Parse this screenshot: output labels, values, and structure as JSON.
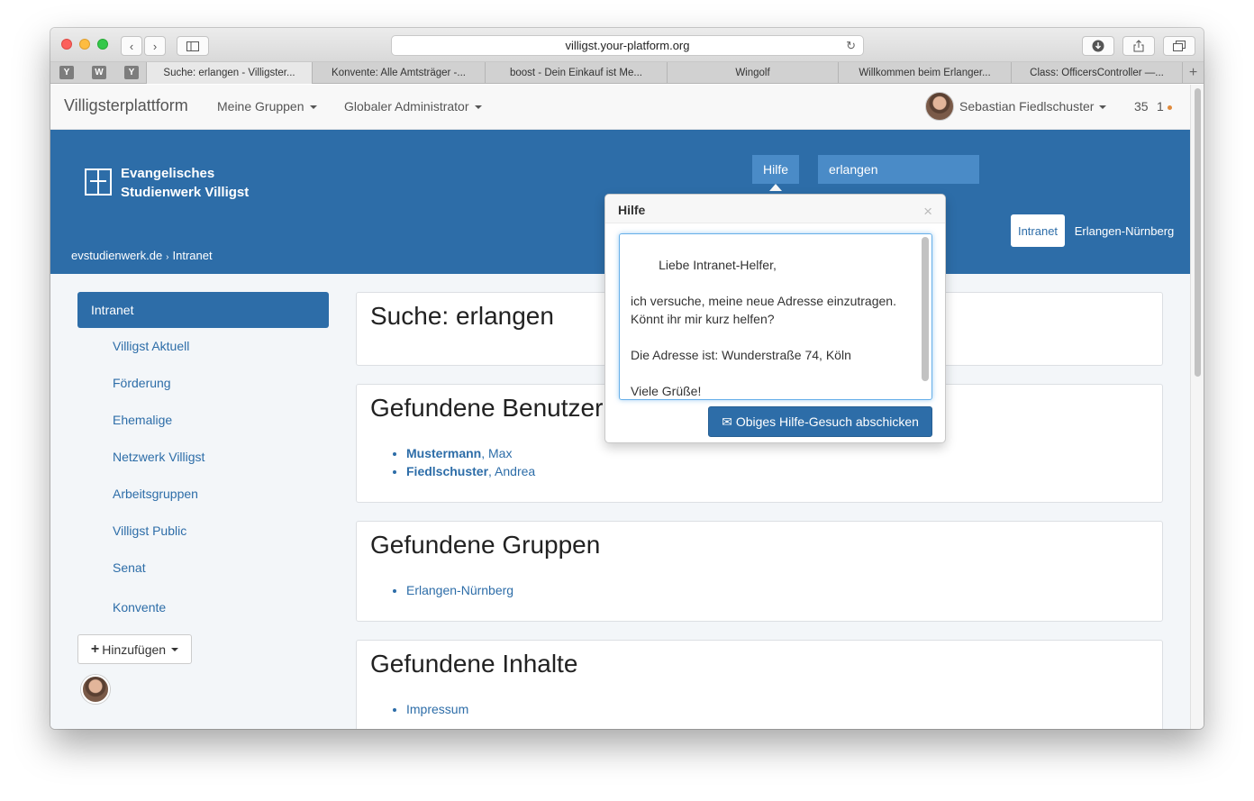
{
  "browser": {
    "url": "villigst.your-platform.org",
    "pinned": [
      "Y",
      "W",
      "Y"
    ],
    "tabs": [
      "Suche: erlangen - Villigster...",
      "Konvente: Alle Amtsträger -...",
      "boost - Dein Einkauf ist Me...",
      "Wingolf",
      "Willkommen beim Erlanger...",
      "Class: OfficersController —..."
    ],
    "new_tab": "+"
  },
  "navbar": {
    "brand": "Villigsterplattform",
    "menu": [
      "Meine Gruppen",
      "Globaler Administrator"
    ],
    "user": "Sebastian Fiedlschuster",
    "count": "35",
    "notifications": "1"
  },
  "header": {
    "logo_line1": "Evangelisches",
    "logo_line2": "Studienwerk Villigst",
    "help": "Hilfe",
    "search_value": "erlangen",
    "breadcrumb": [
      "evstudienwerk.de",
      "Intranet"
    ],
    "pills": [
      "Intranet",
      "Erlangen-Nürnberg"
    ]
  },
  "sidebar": {
    "active": "Intranet",
    "items": [
      "Villigst Aktuell",
      "Förderung",
      "Ehemalige",
      "Netzwerk Villigst",
      "Arbeitsgruppen",
      "Villigst Public",
      "Senat",
      "Konvente"
    ],
    "add_button": "Hinzufügen"
  },
  "main": {
    "search_title": "Suche: erlangen",
    "users_title": "Gefundene Benutzer",
    "users": [
      {
        "last": "Mustermann",
        "first": ", Max"
      },
      {
        "last": "Fiedlschuster",
        "first": ", Andrea"
      }
    ],
    "groups_title": "Gefundene Gruppen",
    "groups": [
      "Erlangen-Nürnberg"
    ],
    "contents_title": "Gefundene Inhalte",
    "contents": [
      "Impressum"
    ]
  },
  "popover": {
    "title": "Hilfe",
    "close": "×",
    "message": "Liebe Intranet-Helfer,\n\nich versuche, meine neue Adresse einzutragen.\nKönnt ihr mir kurz helfen?\n\nDie Adresse ist: Wunderstraße 74, Köln\n\nViele Grüße!\nSebastian",
    "submit": "Obiges Hilfe-Gesuch abschicken"
  }
}
